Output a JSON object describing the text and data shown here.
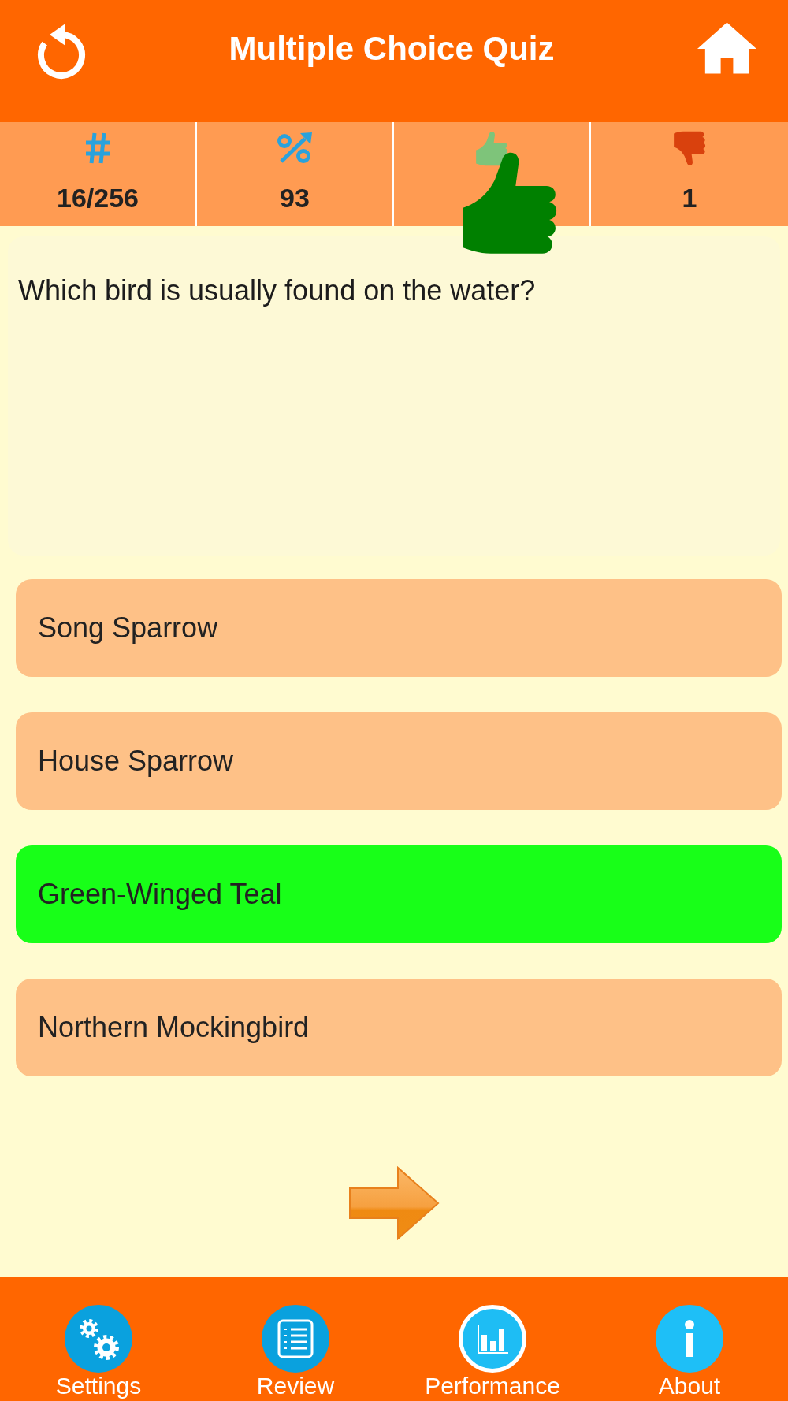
{
  "header": {
    "title": "Multiple Choice Quiz"
  },
  "stats": [
    {
      "kind": "count",
      "value": "16/256"
    },
    {
      "kind": "percent",
      "value": "93"
    },
    {
      "kind": "correct"
    },
    {
      "kind": "wrong",
      "value": "1"
    }
  ],
  "feedback": {
    "correct": true
  },
  "question": "Which bird is usually found on the water?",
  "answers": [
    {
      "text": "Song Sparrow",
      "selected": false
    },
    {
      "text": "House Sparrow",
      "selected": false
    },
    {
      "text": "Green-Winged Teal",
      "selected": true
    },
    {
      "text": "Northern Mockingbird",
      "selected": false
    }
  ],
  "nav": [
    {
      "label": "Settings",
      "kind": "settings",
      "selected": false
    },
    {
      "label": "Review",
      "kind": "review",
      "selected": false
    },
    {
      "label": "Performance",
      "kind": "performance",
      "selected": true
    },
    {
      "label": "About",
      "kind": "about",
      "selected": false
    }
  ]
}
